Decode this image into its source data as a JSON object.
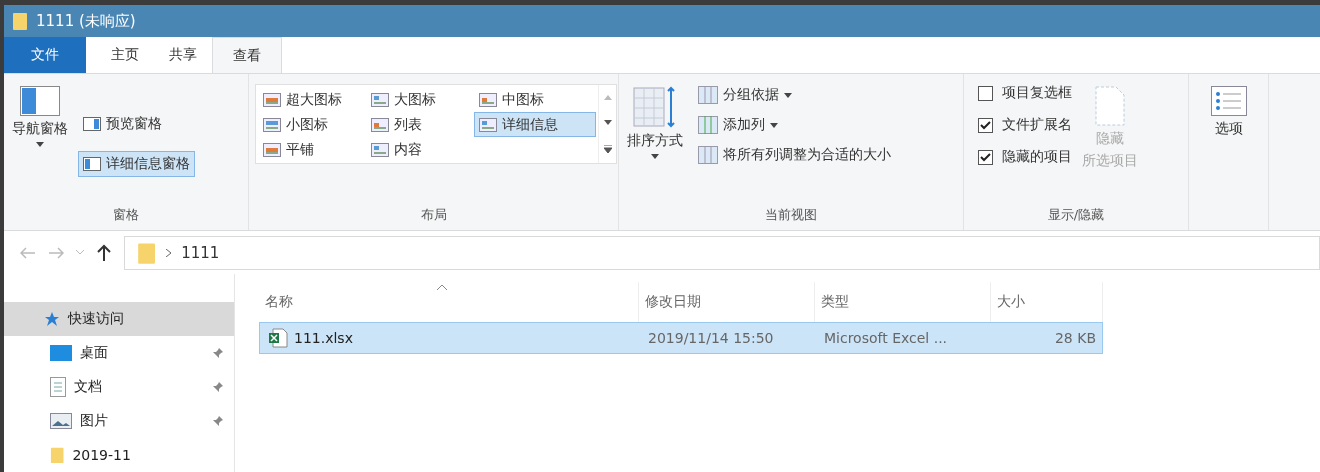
{
  "window": {
    "title": "1111 (未响应)"
  },
  "tabs": [
    {
      "label": "文件",
      "kind": "file",
      "selected": false
    },
    {
      "label": "主页",
      "kind": "normal",
      "selected": false
    },
    {
      "label": "共享",
      "kind": "normal",
      "selected": false
    },
    {
      "label": "查看",
      "kind": "normal",
      "selected": true
    }
  ],
  "ribbon": {
    "panes": {
      "label": "窗格",
      "nav_pane": "导航窗格",
      "items": [
        {
          "label": "预览窗格",
          "selected": false
        },
        {
          "label": "详细信息窗格",
          "selected": true
        }
      ]
    },
    "layout": {
      "label": "布局",
      "options": [
        {
          "label": "超大图标",
          "selected": false
        },
        {
          "label": "大图标",
          "selected": false
        },
        {
          "label": "中图标",
          "selected": false
        },
        {
          "label": "小图标",
          "selected": false
        },
        {
          "label": "列表",
          "selected": false
        },
        {
          "label": "详细信息",
          "selected": true
        },
        {
          "label": "平铺",
          "selected": false
        },
        {
          "label": "内容",
          "selected": false
        }
      ]
    },
    "current_view": {
      "label": "当前视图",
      "sort": "排序方式",
      "items": [
        {
          "label": "分组依据",
          "dropdown": true
        },
        {
          "label": "添加列",
          "dropdown": true
        },
        {
          "label": "将所有列调整为合适的大小",
          "dropdown": false
        }
      ]
    },
    "show_hide": {
      "label": "显示/隐藏",
      "checks": [
        {
          "label": "项目复选框",
          "checked": false
        },
        {
          "label": "文件扩展名",
          "checked": true
        },
        {
          "label": "隐藏的项目",
          "checked": true
        }
      ],
      "hide_selected": {
        "lines": [
          "隐藏",
          "所选项目"
        ],
        "disabled": true
      }
    },
    "options": {
      "label": "选项"
    }
  },
  "address": {
    "path": "1111"
  },
  "nav": [
    {
      "label": "快速访问",
      "kind": "star",
      "selected": true,
      "pinned": false
    },
    {
      "label": "桌面",
      "kind": "desktop",
      "selected": false,
      "pinned": true
    },
    {
      "label": "文档",
      "kind": "document",
      "selected": false,
      "pinned": true
    },
    {
      "label": "图片",
      "kind": "pictures",
      "selected": false,
      "pinned": true
    },
    {
      "label": "2019-11",
      "kind": "folder",
      "selected": false,
      "pinned": false
    }
  ],
  "table": {
    "columns": [
      "名称",
      "修改日期",
      "类型",
      "大小"
    ],
    "rows": [
      {
        "name": "111.xlsx",
        "modified": "2019/11/14 15:50",
        "type": "Microsoft Excel ...",
        "size": "28 KB",
        "selected": true
      }
    ]
  }
}
